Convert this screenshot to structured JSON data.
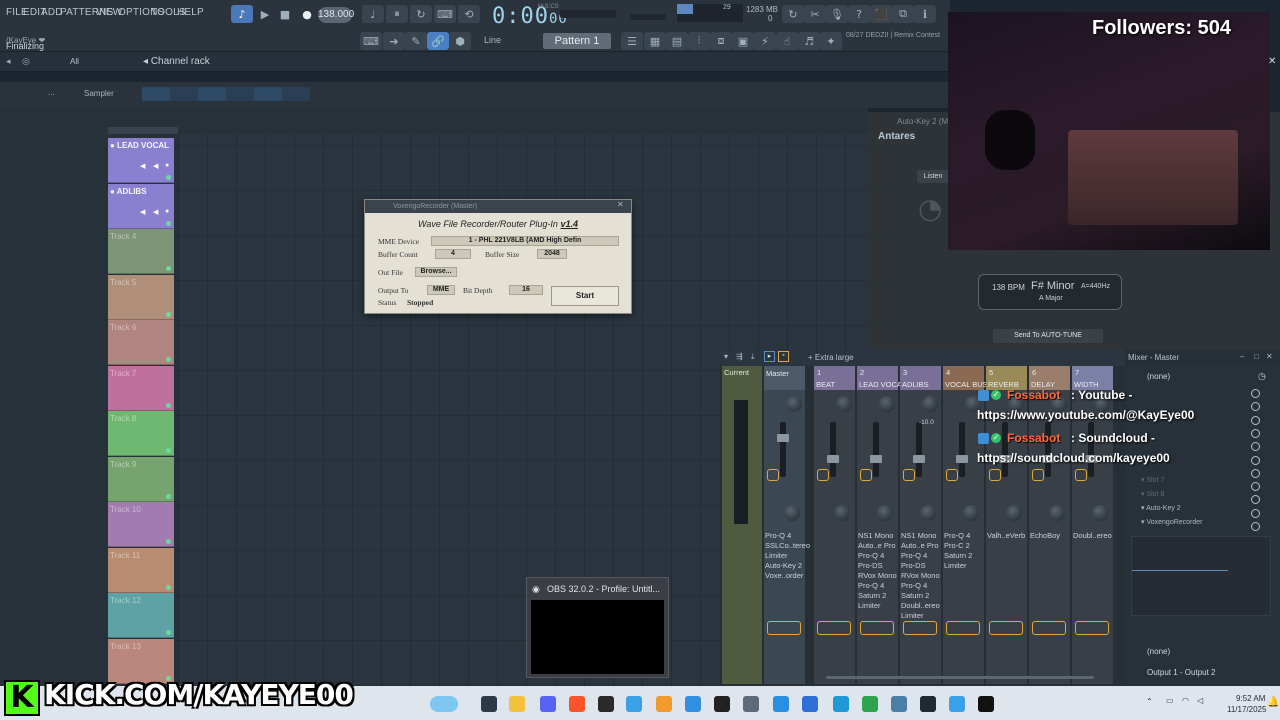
{
  "menu": [
    "FILE",
    "EDIT",
    "ADD",
    "PATTERNS",
    "VIEW",
    "OPTIONS",
    "TOOLS",
    "HELP"
  ],
  "toolbar": {
    "tempo": "138.000",
    "time": "0:00",
    "time_frac": "00",
    "time_unit": "M:S:CS",
    "pattern": "Pattern 1",
    "snap": "Line",
    "cpu_num": "29",
    "mem": "1283 MB",
    "voices": "0",
    "news": "08/27 DEDZII | Remix Contest",
    "hint_user": "(KayEye ❤",
    "hint_status": "Finalizing"
  },
  "browser": {
    "filter": "All",
    "channel_rack": "Channel rack"
  },
  "sampler": {
    "label": "Sampler",
    "dots": "..."
  },
  "tracks": [
    {
      "name": "LEAD VOCAL",
      "color": "#8b7fd0",
      "bold": true
    },
    {
      "name": "ADLIBS",
      "color": "#8b7fd0",
      "bold": true
    },
    {
      "name": "Track 4",
      "color": "#7d9477",
      "bold": false
    },
    {
      "name": "Track 5",
      "color": "#b08f7a",
      "bold": false
    },
    {
      "name": "Track 6",
      "color": "#b08580",
      "bold": false
    },
    {
      "name": "Track 7",
      "color": "#c0709c",
      "bold": false
    },
    {
      "name": "Track 8",
      "color": "#6fb872",
      "bold": false
    },
    {
      "name": "Track 9",
      "color": "#77a46e",
      "bold": false
    },
    {
      "name": "Track 10",
      "color": "#a27bb0",
      "bold": false
    },
    {
      "name": "Track 11",
      "color": "#b98c72",
      "bold": false
    },
    {
      "name": "Track 12",
      "color": "#5ea2a6",
      "bold": false
    },
    {
      "name": "Track 13",
      "color": "#b9877b",
      "bold": false
    }
  ],
  "recorder": {
    "titlebar": "VoxengoRecorder (Master)",
    "heading": "Wave File Recorder/Router Plug-In",
    "version": "v1.4",
    "mme_label": "MME Device",
    "mme_value": "1 - PHL 221V8LB (AMD High Defin",
    "buffer_count_label": "Buffer Count",
    "buffer_count": "4",
    "buffer_size_label": "Buffer Size",
    "buffer_size": "2048",
    "out_file_label": "Out File",
    "browse": "Browse...",
    "output_to_label": "Output To",
    "output_to": "MME",
    "bit_depth_label": "Bit Depth",
    "bit_depth": "16",
    "status_label": "Status",
    "status": "Stopped",
    "start": "Start"
  },
  "stream": {
    "followers": "Followers: 504",
    "kick": "KICK.COM/KAYEYE00"
  },
  "autotune": {
    "title": "Auto-Key 2 (M",
    "brand": "Antares",
    "listen": "Listen",
    "bpm": "138 BPM",
    "key": "F# Minor",
    "tuning": "A=440Hz",
    "relative": "A Major",
    "send": "Send To AUTO-TUNE"
  },
  "mixer": {
    "size": "Extra large",
    "title": "Mixer - Master",
    "current": "Current",
    "strips": [
      {
        "num": "",
        "name": "Master",
        "fx": [
          "Pro-Q 4",
          "SSLCo..tereo",
          "Limiter",
          "Auto-Key 2",
          "Voxe..order"
        ],
        "color": "#4b5a66"
      },
      {
        "num": "1",
        "name": "BEAT",
        "fx": [],
        "color": "#7a6f96"
      },
      {
        "num": "2",
        "name": "LEAD VOCAL",
        "fx": [
          "NS1 Mono",
          "Auto..e Pro",
          "Pro-Q 4",
          "Pro-DS",
          "RVox Mono",
          "Pro-Q 4",
          "Saturn 2",
          "Limiter"
        ],
        "color": "#7a6f96"
      },
      {
        "num": "3",
        "name": "ADLIBS",
        "fx": [
          "NS1 Mono",
          "Auto..e Pro",
          "Pro-Q 4",
          "Pro-DS",
          "RVox Mono",
          "Pro-Q 4",
          "Saturn 2",
          "Doubl..ereo",
          "Limiter"
        ],
        "color": "#7a6f96"
      },
      {
        "num": "4",
        "name": "VOCAL BUS",
        "fx": [
          "Pro-Q 4",
          "Pro-C 2",
          "Saturn 2",
          "Limiter"
        ],
        "color": "#8a6a52"
      },
      {
        "num": "5",
        "name": "REVERB",
        "fx": [
          "Valh..eVerb"
        ],
        "color": "#9a8a58"
      },
      {
        "num": "6",
        "name": "DELAY",
        "fx": [
          "EchoBoy"
        ],
        "color": "#9a7d6a"
      },
      {
        "num": "7",
        "name": "WIDTH",
        "fx": [
          "Doubl..ereo"
        ],
        "color": "#7c7fa6"
      }
    ],
    "insert_none": "(none)",
    "slots": [
      "Slot 7",
      "Slot 8",
      "Auto-Key 2",
      "VoxengoRecorder"
    ],
    "send_none": "(none)",
    "output": "Output 1 - Output 2",
    "level_mark": "-10.0"
  },
  "chat": [
    {
      "user": "Fossabot",
      "sep": " : ",
      "text": "Youtube -",
      "link": "https://www.youtube.com/@KayEye00"
    },
    {
      "user": "Fossabot",
      "sep": " : ",
      "text": "Soundcloud -",
      "link": "https://soundcloud.com/kayeye00"
    }
  ],
  "obs": {
    "title": "OBS 32.0.2 - Profile: Untitl..."
  },
  "tray": {
    "time": "9:52 AM",
    "date": "11/17/2025"
  },
  "colors": {
    "accent": "#4a7fc4",
    "brand_kick": "#53fc18",
    "chat_user": "#ff6a3a",
    "fx_ring": "#e2a73b"
  },
  "icons": [
    "record-icon",
    "play-icon",
    "stop-icon",
    "search-icon",
    "settings-icon",
    "close-icon",
    "microphone-icon",
    "link-icon"
  ]
}
